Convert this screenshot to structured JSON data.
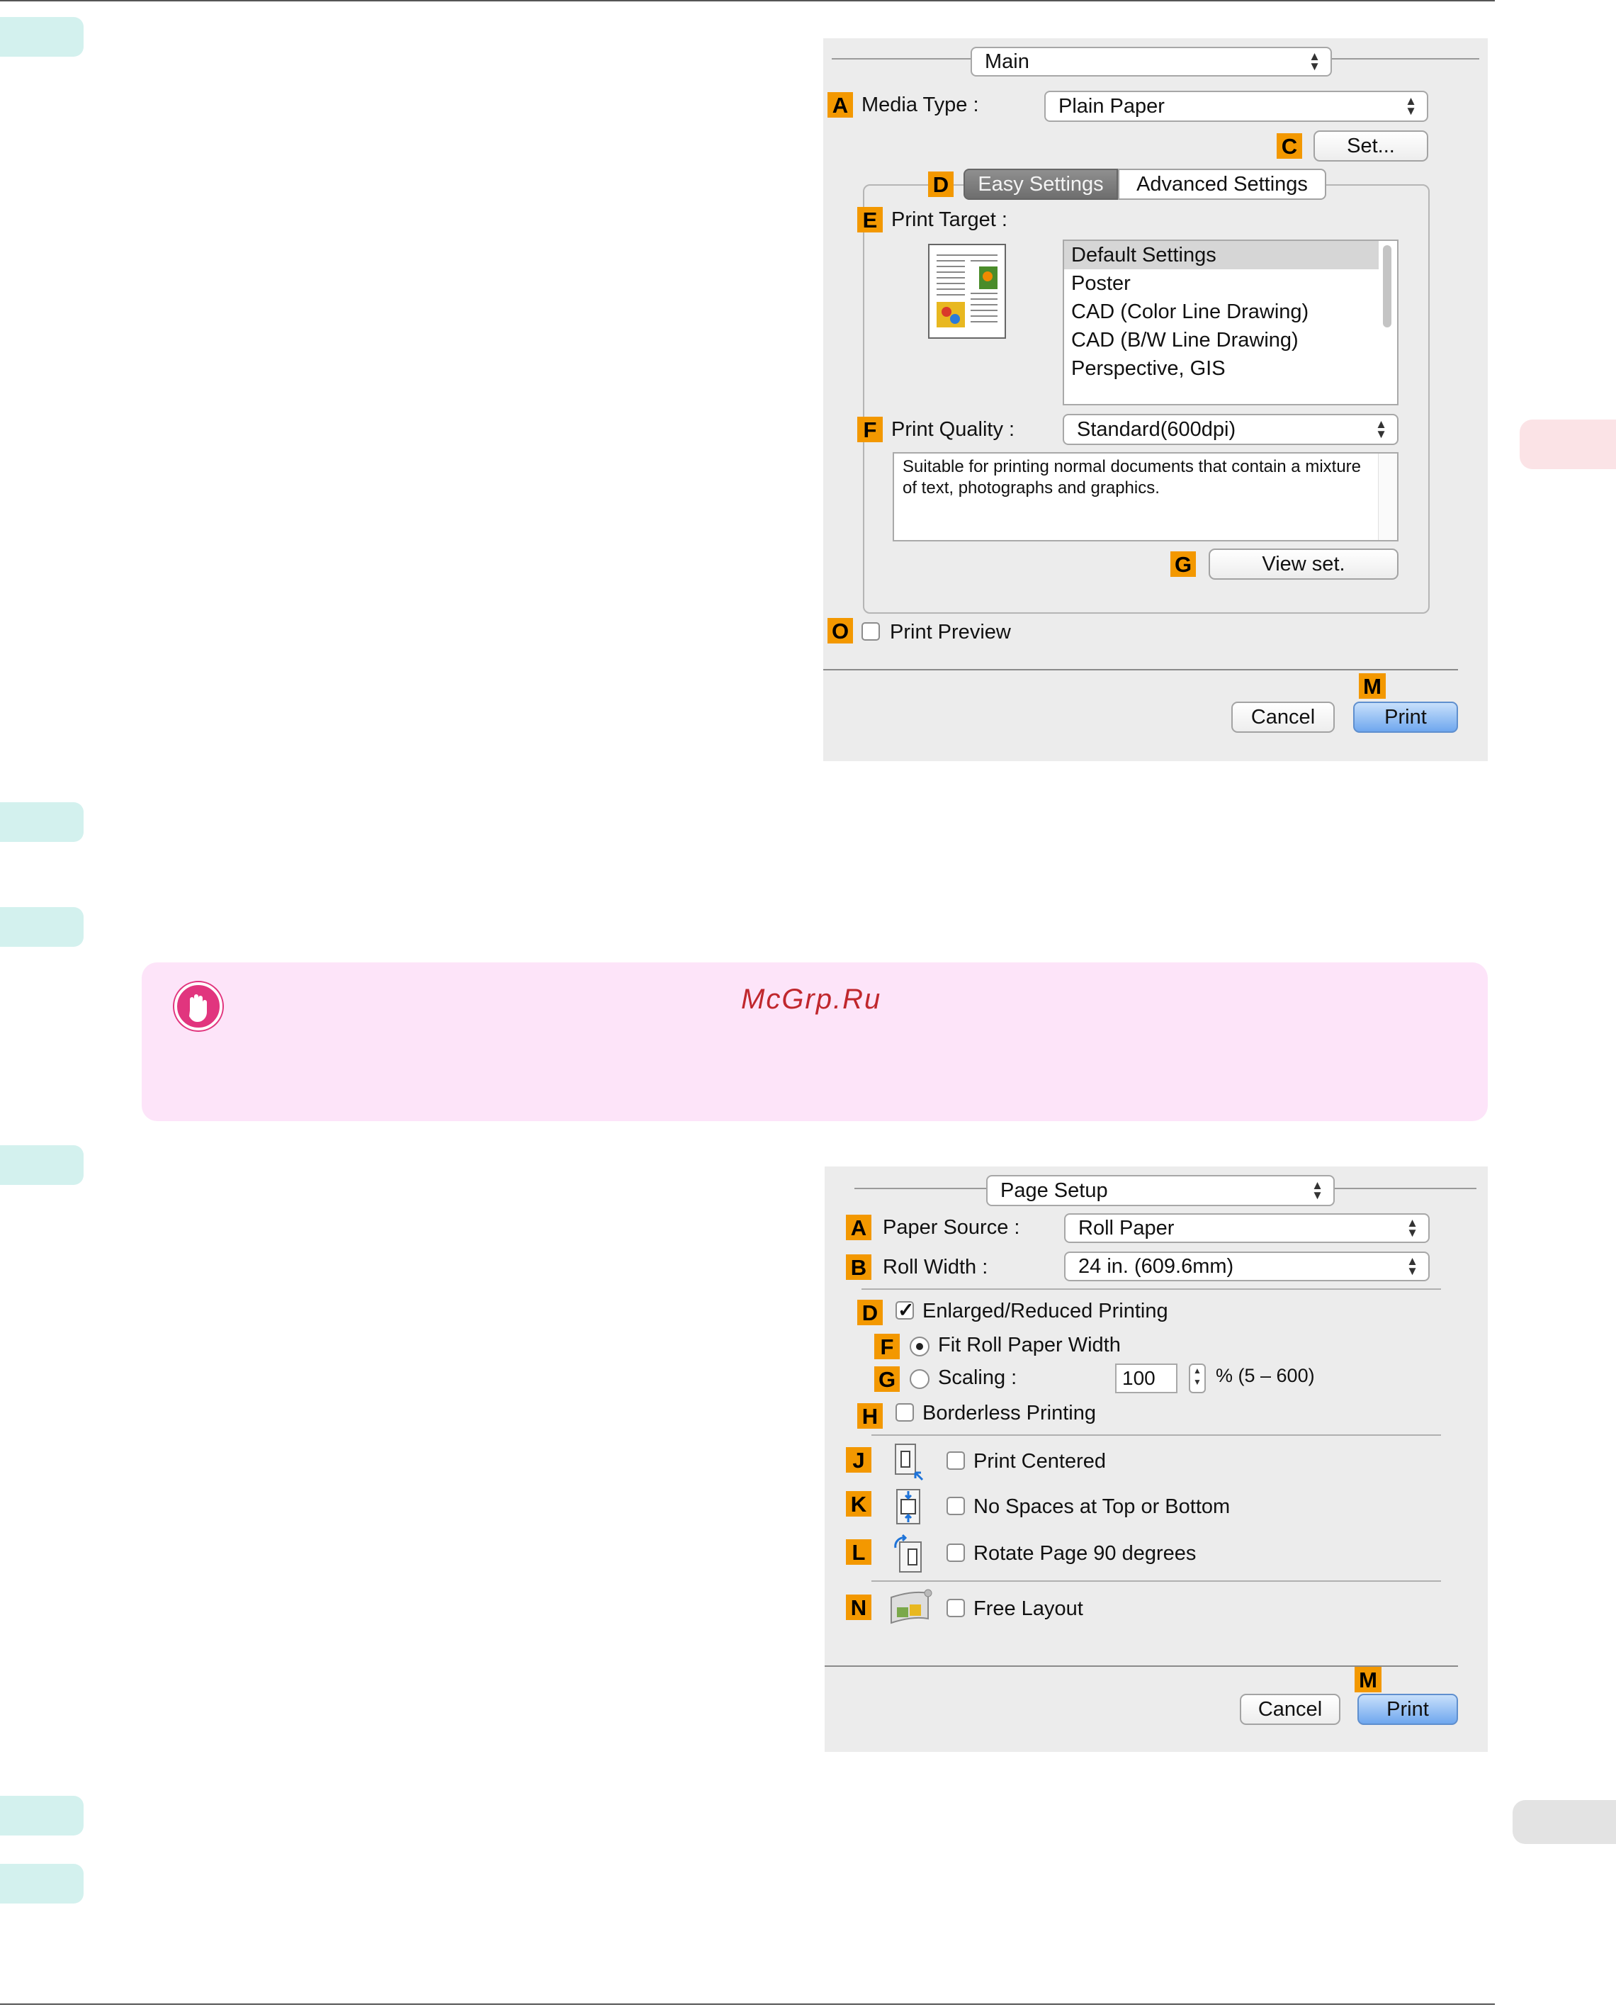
{
  "watermark": "McGrp.Ru",
  "dialog1": {
    "section_popup": "Main",
    "media_type": {
      "badge": "A",
      "label": "Media Type :",
      "value": "Plain Paper"
    },
    "set_button": {
      "badge": "C",
      "label": "Set..."
    },
    "tabs": {
      "badge": "D",
      "easy": "Easy Settings",
      "advanced": "Advanced Settings"
    },
    "print_target": {
      "badge": "E",
      "label": "Print Target :",
      "items": [
        "Default Settings",
        "Poster",
        "CAD (Color Line Drawing)",
        "CAD (B/W Line Drawing)",
        "Perspective, GIS"
      ]
    },
    "print_quality": {
      "badge": "F",
      "label": "Print Quality :",
      "value": "Standard(600dpi)"
    },
    "description": "Suitable for printing normal documents that contain a mixture of text, photographs and graphics.",
    "view_set": {
      "badge": "G",
      "label": "View set."
    },
    "print_preview": {
      "badge": "O",
      "label": "Print Preview",
      "checked": false
    },
    "cancel": "Cancel",
    "print": {
      "badge": "M",
      "label": "Print"
    }
  },
  "dialog2": {
    "section_popup": "Page Setup",
    "paper_source": {
      "badge": "A",
      "label": "Paper Source :",
      "value": "Roll Paper"
    },
    "roll_width": {
      "badge": "B",
      "label": "Roll Width :",
      "value": "24 in. (609.6mm)"
    },
    "enlarged": {
      "badge": "D",
      "label": "Enlarged/Reduced Printing",
      "checked": true
    },
    "fit_roll": {
      "badge": "F",
      "label": "Fit Roll Paper Width",
      "selected": true
    },
    "scaling": {
      "badge": "G",
      "label": "Scaling :",
      "value": "100",
      "range": "% (5 – 600)",
      "selected": false
    },
    "borderless": {
      "badge": "H",
      "label": "Borderless Printing",
      "checked": false
    },
    "print_centered": {
      "badge": "J",
      "label": "Print Centered",
      "checked": false,
      "icon": "page-centered-icon"
    },
    "no_spaces": {
      "badge": "K",
      "label": "No Spaces at Top or Bottom",
      "checked": false,
      "icon": "no-spaces-icon"
    },
    "rotate": {
      "badge": "L",
      "label": "Rotate Page 90 degrees",
      "checked": false,
      "icon": "rotate-page-icon"
    },
    "free_layout": {
      "badge": "N",
      "label": "Free Layout",
      "checked": false,
      "icon": "free-layout-icon"
    },
    "cancel": "Cancel",
    "print": {
      "badge": "M",
      "label": "Print"
    }
  },
  "colors": {
    "badge": "#f39800",
    "step_tab": "#d3f1ee",
    "note_bg": "#fde4f9",
    "note_icon": "#e1357e",
    "primary_button": "#6fa7ee"
  }
}
